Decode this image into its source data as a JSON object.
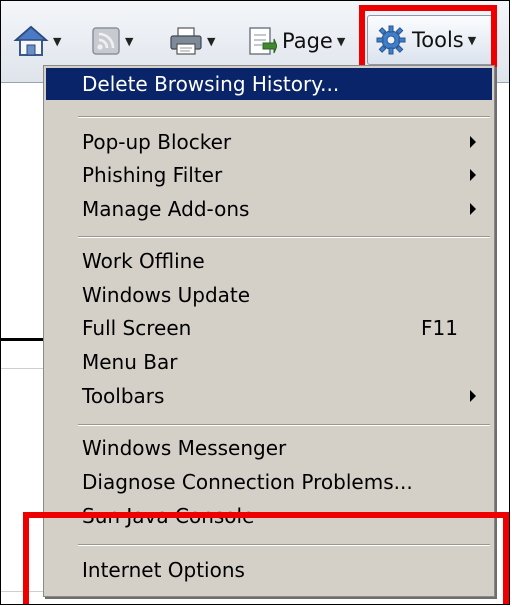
{
  "toolbar": {
    "home_icon": "home-icon",
    "feeds_icon": "feeds-icon",
    "print_icon": "printer-icon",
    "page_icon": "page-icon",
    "page_label": "Page",
    "tools_icon": "gear-icon",
    "tools_label": "Tools",
    "accent": "#ee0000"
  },
  "menu": {
    "items": [
      {
        "label": "Delete Browsing History...",
        "selected": true
      },
      {
        "label": "Pop-up Blocker",
        "submenu": true
      },
      {
        "label": "Phishing Filter",
        "submenu": true
      },
      {
        "label": "Manage Add-ons",
        "submenu": true
      },
      {
        "label": "Work Offline"
      },
      {
        "label": "Windows Update"
      },
      {
        "label": "Full Screen",
        "shortcut": "F11"
      },
      {
        "label": "Menu Bar"
      },
      {
        "label": "Toolbars",
        "submenu": true
      },
      {
        "label": "Windows Messenger"
      },
      {
        "label": "Diagnose Connection Problems..."
      },
      {
        "label": "Sun Java Console"
      },
      {
        "label": "Internet Options"
      }
    ],
    "selection_color": "#0a246a",
    "background": "#d4d0c8"
  }
}
